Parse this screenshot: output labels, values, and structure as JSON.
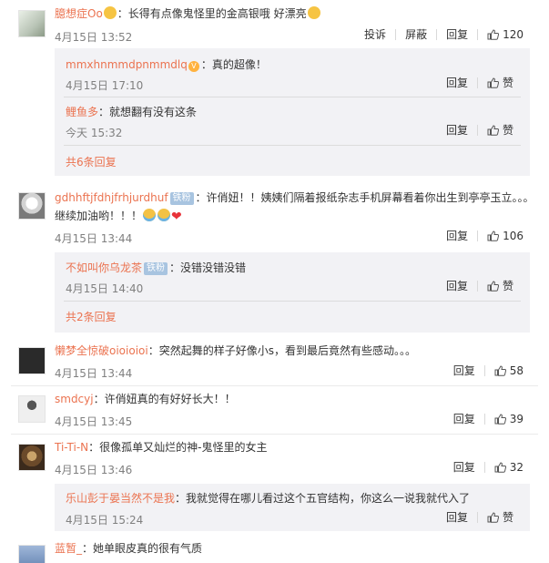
{
  "labels": {
    "report": "投诉",
    "block": "屏蔽",
    "reply": "回复",
    "like": "赞"
  },
  "comments": [
    {
      "user": "臆想症Oo",
      "text": "：长得有点像鬼怪里的金高银哦 好漂亮",
      "date": "4月15日 13:52",
      "likes": "120",
      "replies": [
        {
          "user": "mmxhnmmdpnmmdlq",
          "text": "：真的超像！",
          "date": "4月15日 17:10"
        },
        {
          "user": "鲤鱼多",
          "text": "：就想翻有没有这条",
          "date": "今天 15:32"
        }
      ],
      "more": "共6条回复"
    },
    {
      "user": "gdhhftjfdhjfrhjurdhuf",
      "badge": "铁粉",
      "text": "：许俏妞！！姨姨们隔着报纸杂志手机屏幕看着你出生到亭亭玉立。。。继续加油哟！！！",
      "date": "4月15日 13:44",
      "likes": "106",
      "replies": [
        {
          "user": "不如叫你乌龙茶",
          "badge": "铁粉",
          "text": "：没错没错没错",
          "date": "4月15日 14:40"
        }
      ],
      "more": "共2条回复"
    },
    {
      "user": "懒梦全惊破oioioioi",
      "text": "：突然起舞的样子好像小s，看到最后竟然有些感动。。。",
      "date": "4月15日 13:44",
      "likes": "58"
    },
    {
      "user": "smdcyj",
      "text": "：许俏妞真的有好好长大！！",
      "date": "4月15日 13:45",
      "likes": "39"
    },
    {
      "user": "Ti-Ti-N",
      "text": "：很像孤单又灿烂的神-鬼怪里的女主",
      "date": "4月15日 13:46",
      "likes": "32",
      "replies": [
        {
          "user": "乐山彭于晏当然不是我",
          "text": "：我就觉得在哪儿看过这个五官结构，你这么一说我就代入了",
          "date": "4月15日 15:24"
        }
      ]
    },
    {
      "user": "蓝暂_",
      "text": "：她单眼皮真的很有气质"
    }
  ]
}
